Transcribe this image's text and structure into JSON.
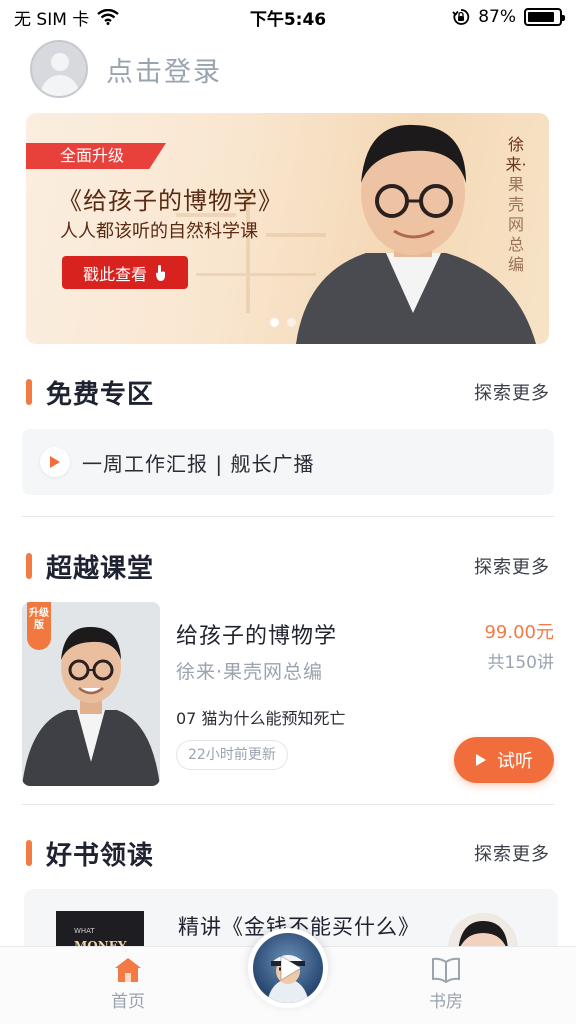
{
  "status_bar": {
    "carrier": "无 SIM 卡",
    "time": "下午5:46",
    "battery_percent": "87%",
    "battery_level": 0.87
  },
  "login": {
    "prompt": "点击登录"
  },
  "banner": {
    "tag": "全面升级",
    "title": "《给孩子的博物学》",
    "subtitle": "人人都该听的自然科学课",
    "button": "戳此查看",
    "speaker_name": "徐来",
    "speaker_sep": "·",
    "speaker_title": "果壳网总编",
    "slide_count": 2,
    "active_slide": 1
  },
  "free_zone": {
    "title": "免费专区",
    "more": "探索更多",
    "item": "一周工作汇报 | 舰长广播"
  },
  "classroom": {
    "title": "超越课堂",
    "more": "探索更多",
    "course": {
      "badge": "升级版",
      "title": "给孩子的博物学",
      "author": "徐来·果壳网总编",
      "price": "99.00元",
      "lessons": "共150讲",
      "episode": "07 猫为什么能预知死亡",
      "updated": "22小时前更新",
      "trial": "试听"
    }
  },
  "books": {
    "title": "好书领读",
    "more": "探索更多",
    "item_title": "精讲《金钱不能买什么》",
    "cover_small": "WHAT",
    "cover_main": "MONEY"
  },
  "tab_bar": {
    "home": "首页",
    "library": "书房"
  },
  "colors": {
    "accent": "#f37a45",
    "banner_red": "#d7221e",
    "muted": "#9aa3b0"
  },
  "icons": {
    "wifi": "wifi-icon",
    "lock_rotation": "orientation-lock-icon",
    "battery": "battery-icon",
    "play": "play-icon",
    "home": "home-icon",
    "book": "book-icon",
    "tap": "hand-tap-icon"
  }
}
